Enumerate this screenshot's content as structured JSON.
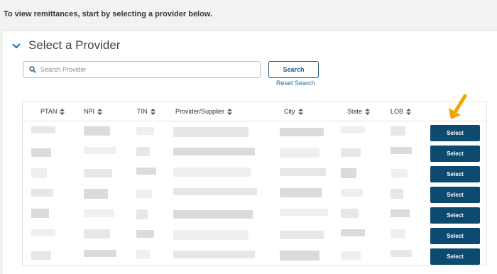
{
  "intro_text": "To view remittances, start by selecting a provider below.",
  "panel": {
    "title": "Select a Provider"
  },
  "search": {
    "placeholder": "Search Provider",
    "value": "",
    "button_label": "Search",
    "reset_label": "Reset Search"
  },
  "table": {
    "columns": [
      "PTAN",
      "NPI",
      "TIN",
      "Provider/Supplier",
      "City",
      "State",
      "LOB"
    ],
    "select_label": "Select",
    "row_count": 7
  },
  "colors": {
    "primary": "#0d4a70",
    "link": "#1f6fa8",
    "arrow": "#f0a500"
  }
}
